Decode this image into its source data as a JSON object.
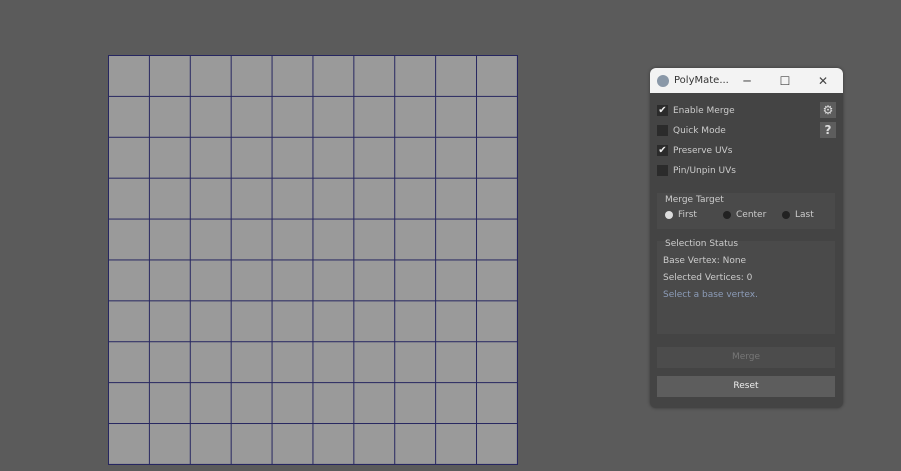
{
  "window": {
    "title": "PolyMate...",
    "minimize": "─",
    "maximize": "☐",
    "close": "✕"
  },
  "options": [
    {
      "label": "Enable Merge",
      "checked": true
    },
    {
      "label": "Quick Mode",
      "checked": false
    },
    {
      "label": "Preserve UVs",
      "checked": true
    },
    {
      "label": "Pin/Unpin UVs",
      "checked": false
    }
  ],
  "icons": {
    "settings": "⚙",
    "help": "?",
    "check": "✔"
  },
  "merge_target": {
    "title": "Merge Target",
    "options": [
      "First",
      "Center",
      "Last"
    ],
    "selected": "First"
  },
  "status": {
    "title": "Selection Status",
    "base_vertex": "Base Vertex: None",
    "selected": "Selected Vertices: 0",
    "hint": "Select a base vertex."
  },
  "buttons": {
    "merge": "Merge",
    "reset": "Reset"
  }
}
